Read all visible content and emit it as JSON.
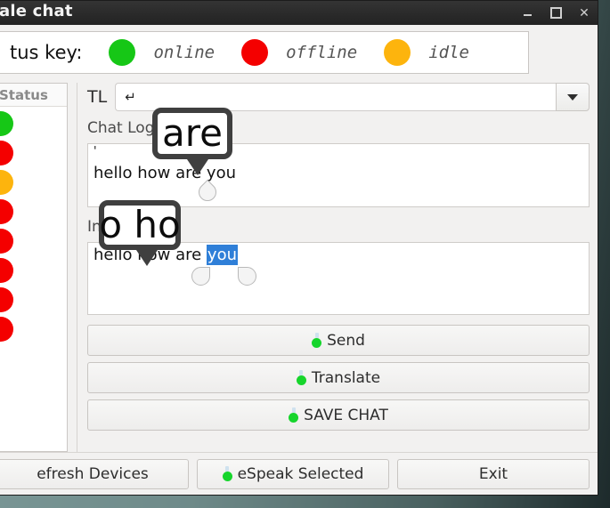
{
  "window": {
    "title": "ale chat",
    "controls": {
      "minimize": "−",
      "maximize": "□",
      "close": "✕"
    }
  },
  "status_key": {
    "label": "tus key:",
    "items": [
      {
        "state": "online",
        "color": "#16c716",
        "label": "online"
      },
      {
        "state": "offline",
        "color": "#f40000",
        "label": "offline"
      },
      {
        "state": "idle",
        "color": "#fdb40d",
        "label": "idle"
      }
    ]
  },
  "device_list": {
    "header": "Status",
    "rows": [
      {
        "status": "online",
        "color": "#16c716"
      },
      {
        "status": "offline",
        "color": "#f40000"
      },
      {
        "status": "idle",
        "color": "#fdb40d"
      },
      {
        "status": "offline",
        "color": "#f40000"
      },
      {
        "status": "offline",
        "color": "#f40000"
      },
      {
        "status": "offline",
        "color": "#f40000"
      },
      {
        "status": "offline",
        "color": "#f40000"
      },
      {
        "status": "offline",
        "color": "#f40000"
      }
    ]
  },
  "translate_row": {
    "label": "TL",
    "combo_value": "↵",
    "arrow": "▼"
  },
  "chat_log": {
    "label": "Chat Log Visible",
    "tick": "'",
    "line": "hello how are you"
  },
  "input": {
    "label": "Input",
    "text_before": "hello how are ",
    "text_selected": "you"
  },
  "actions": [
    {
      "name": "send",
      "label": "Send",
      "icon": "flask-icon"
    },
    {
      "name": "translate",
      "label": "Translate",
      "icon": "flask-icon"
    },
    {
      "name": "save-chat",
      "label": "SAVE CHAT",
      "icon": "flask-icon"
    }
  ],
  "bottom_bar": [
    {
      "name": "refresh-devices",
      "label": "efresh Devices",
      "icon": null
    },
    {
      "name": "espeak-selected",
      "label": "eSpeak Selected",
      "icon": "flask-icon"
    },
    {
      "name": "exit",
      "label": "Exit",
      "icon": null
    }
  ],
  "callouts": [
    {
      "name": "magnifier-are",
      "text": "are"
    },
    {
      "name": "magnifier-oho",
      "text": "o ho"
    }
  ],
  "colors": {
    "online": "#16c716",
    "offline": "#f40000",
    "idle": "#fdb40d",
    "selection": "#2f7fd8",
    "titlebar": "#2a2a2a",
    "window_bg": "#f2f1f0"
  }
}
